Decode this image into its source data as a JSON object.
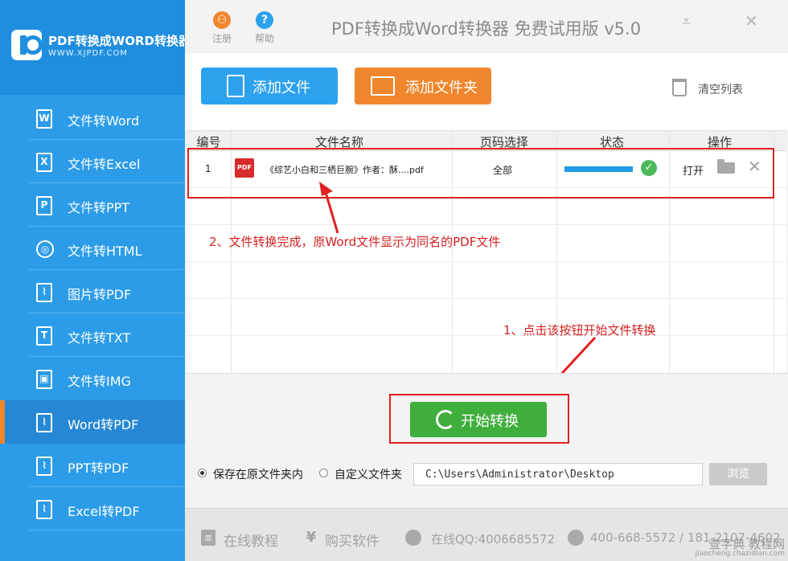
{
  "app": {
    "logo_title": "PDF转换成WORD转换器",
    "logo_url": "WWW.XJPDF.COM",
    "title": "PDF转换成Word转换器 免费试用版 v5.0"
  },
  "header": {
    "register_label": "注册",
    "help_label": "帮助",
    "register_glyph": "⚇",
    "help_glyph": "?",
    "minimize_glyph": "⩡",
    "close_glyph": "✕"
  },
  "sidebar": {
    "items": [
      {
        "label": "文件转Word",
        "icon": "W"
      },
      {
        "label": "文件转Excel",
        "icon": "X"
      },
      {
        "label": "文件转PPT",
        "icon": "P"
      },
      {
        "label": "文件转HTML",
        "icon": "◎"
      },
      {
        "label": "图片转PDF",
        "icon": "⌇"
      },
      {
        "label": "文件转TXT",
        "icon": "T"
      },
      {
        "label": "文件转IMG",
        "icon": "▣"
      },
      {
        "label": "Word转PDF",
        "icon": "⌇"
      },
      {
        "label": "PPT转PDF",
        "icon": "⌇"
      },
      {
        "label": "Excel转PDF",
        "icon": "⌇"
      }
    ],
    "active_index": 7
  },
  "toolbar": {
    "add_file_label": "添加文件",
    "add_folder_label": "添加文件夹",
    "clear_list_label": "清空列表",
    "add_file_color": "#2ca2ee",
    "add_folder_color": "#f0862d"
  },
  "table": {
    "headers": [
      "编号",
      "文件名称",
      "页码选择",
      "状态",
      "操作"
    ],
    "rows": [
      {
        "index": "1",
        "file_type": "PDF",
        "file_name": "《综艺小白和三栖巨腕》作者：酥....pdf",
        "page_select": "全部",
        "progress": 1.0,
        "status_glyph": "✓",
        "open_label": "打开",
        "delete_glyph": "✕"
      }
    ]
  },
  "annotations": {
    "note_2": "2、文件转换完成，原Word文件显示为同名的PDF文件",
    "note_1": "1、点击该按钮开始文件转换"
  },
  "start": {
    "label": "开始转换",
    "color": "#3fae3c"
  },
  "output": {
    "option_original": "保存在原文件夹内",
    "option_custom": "自定义文件夹",
    "selected": "original",
    "path": "C:\\Users\\Administrator\\Desktop",
    "browse_label": "浏览"
  },
  "footer": {
    "tutorial_label": "在线教程",
    "buy_label": "购买软件",
    "qq_label": "在线QQ:4006685572",
    "phone_label": "400-668-5572 / 181-2107-4602",
    "tutorial_glyph": "≡",
    "buy_glyph": "¥"
  },
  "watermark": {
    "top": "查字典 教程网",
    "bottom": "jiaocheng.chazidian.com"
  }
}
